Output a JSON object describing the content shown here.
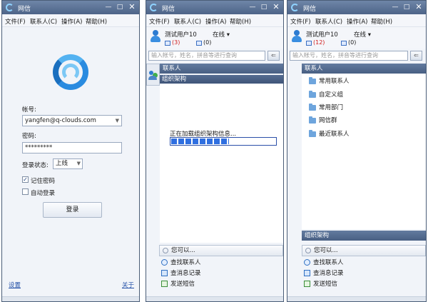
{
  "app_name": "网信",
  "menu": [
    "文件(F)",
    "联系人(C)",
    "操作(A)",
    "帮助(H)"
  ],
  "window_buttons": {
    "minimize": "—",
    "maximize": "□",
    "close": "✕"
  },
  "login": {
    "account_label": "帐号:",
    "account_value": "yangfen@q-clouds.com",
    "password_label": "密码:",
    "password_value": "*********",
    "status_label": "登录状态:",
    "status_value": "上线",
    "remember_label": "记住密码",
    "remember_checked": true,
    "auto_login_label": "自动登录",
    "auto_login_checked": false,
    "login_button": "登录",
    "settings_link": "设置",
    "about_link": "关于"
  },
  "loading_window": {
    "user_name": "测试用户10",
    "status": "在线 ▾",
    "mail_count": "(3)",
    "sms_count": "(0)",
    "search_placeholder": "输入帐号，姓名，拼音等进行查询",
    "section_contacts": "联系人",
    "section_org": "组织架构",
    "loading_text": "正在加载组织架构信息...",
    "loading_progress": 0.55,
    "can_do": "您可以...",
    "actions": [
      "查找联系人",
      "查消息记录",
      "发送短信"
    ]
  },
  "contacts_window": {
    "user_name": "测试用户10",
    "status": "在线 ▾",
    "mail_count": "(12)",
    "sms_count": "(0)",
    "search_placeholder": "输入帐号，姓名，拼音等进行查询",
    "section_contacts": "联系人",
    "groups": [
      "常用联系人",
      "自定义组",
      "常用部门",
      "网信群",
      "最近联系人"
    ],
    "section_org": "组织架构",
    "can_do": "您可以...",
    "actions": [
      "查找联系人",
      "查消息记录",
      "发送短信"
    ]
  }
}
